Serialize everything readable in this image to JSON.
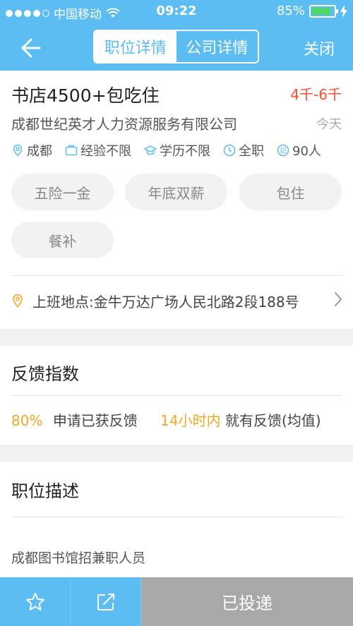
{
  "status": {
    "carrier": "中国移动",
    "time": "09:22",
    "battery": "85%",
    "battery_level": 0.85
  },
  "nav": {
    "tabs": [
      "职位详情",
      "公司详情"
    ],
    "active_tab": 0,
    "close_label": "关闭"
  },
  "job": {
    "title": "书店4500+包吃住",
    "salary": "4千-6千",
    "company": "成都世纪英才人力资源服务有限公司",
    "posted": "今天",
    "meta": {
      "city": "成都",
      "experience": "经验不限",
      "education": "学历不限",
      "type": "全职",
      "headcount": "90人"
    },
    "benefits": [
      "五险一金",
      "年底双薪",
      "包住",
      "餐补"
    ],
    "location": "上班地点:金牛万达广场人民北路2段188号"
  },
  "feedback": {
    "title": "反馈指数",
    "rate": "80%",
    "rate_label": "申请已获反馈",
    "time": "14小时内",
    "time_label": "就有反馈(均值)"
  },
  "description": {
    "title": "职位描述",
    "text": "成都图书馆招兼职人员"
  },
  "bottom": {
    "applied_label": "已投递"
  },
  "colors": {
    "primary": "#5bbdf2",
    "salary": "#ff4d2d",
    "highlight": "#f5a623",
    "disabled": "#a8a8a8"
  }
}
